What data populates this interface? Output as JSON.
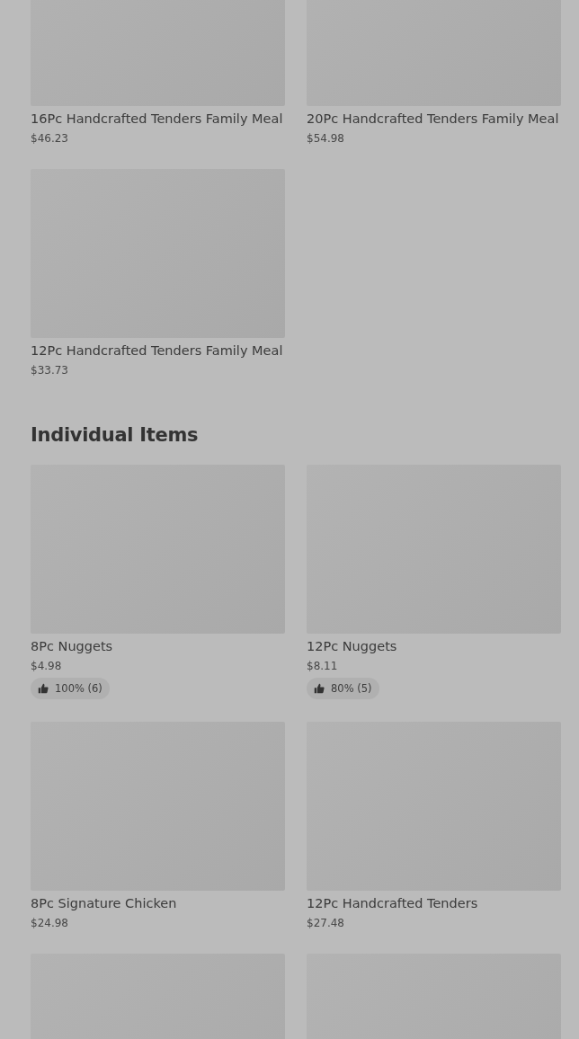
{
  "sections": [
    {
      "items": [
        {
          "kind": "product",
          "name": "16Pc Handcrafted Tenders Family Meal",
          "price": "$46.23"
        },
        {
          "kind": "product",
          "name": "20Pc Handcrafted Tenders Family Meal",
          "price": "$54.98"
        },
        {
          "kind": "product",
          "name": "12Pc Handcrafted Tenders Family Meal",
          "price": "$33.73"
        }
      ]
    },
    {
      "heading": "Individual Items",
      "items": [
        {
          "kind": "product",
          "name": "8Pc Nuggets",
          "price": "$4.98",
          "rating": "100% (6)"
        },
        {
          "kind": "product",
          "name": "12Pc Nuggets",
          "price": "$8.11",
          "rating": "80% (5)"
        },
        {
          "kind": "product",
          "name": "8Pc Signature Chicken",
          "price": "$24.98"
        },
        {
          "kind": "product",
          "name": "12Pc Handcrafted Tenders",
          "price": "$27.48"
        },
        {
          "kind": "picture"
        },
        {
          "kind": "picture"
        }
      ]
    }
  ]
}
